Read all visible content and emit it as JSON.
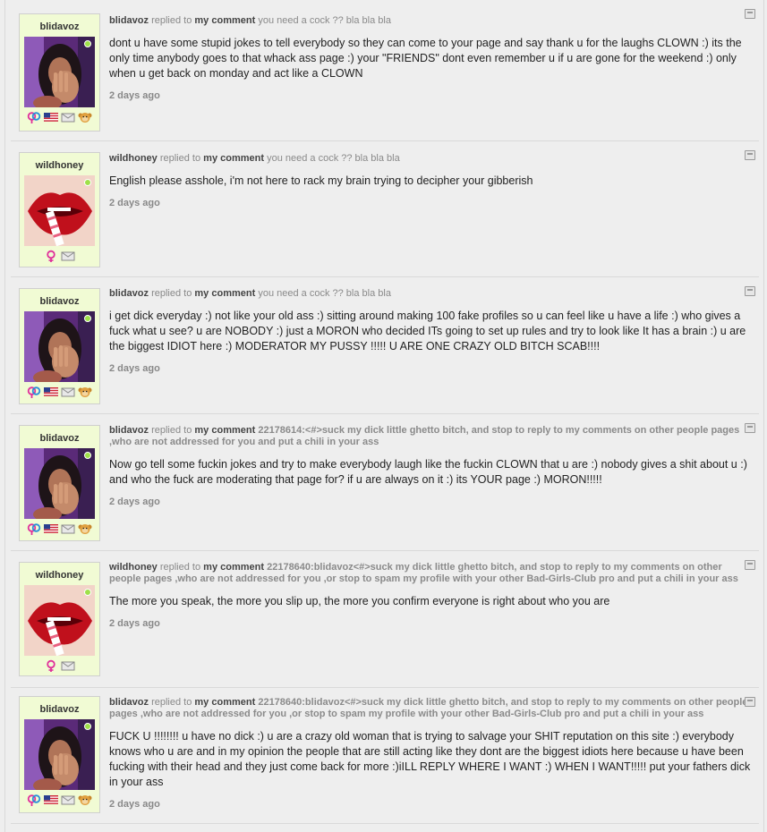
{
  "labels": {
    "replied_to": "replied to",
    "my_comment": "my comment"
  },
  "comments": [
    {
      "user": "blidavoz",
      "quote": "you need a cock ?? bla bla bla",
      "text": "dont u have some stupid jokes to tell everybody so they can come to your page and say thank u for the laughs CLOWN :) its the only time anybody goes to that whack ass page :) your \"FRIENDS\" dont even remember u if u are gone for the weekend :) only when u get back on monday and act like a CLOWN",
      "time": "2 days ago"
    },
    {
      "user": "wildhoney",
      "quote": "you need a cock ?? bla bla bla",
      "text": "English please asshole, i'm not here to rack my brain trying to decipher your gibberish",
      "time": "2 days ago"
    },
    {
      "user": "blidavoz",
      "quote": "you need a cock ?? bla bla bla",
      "text": "i get dick everyday :) not like your old ass :) sitting around making 100 fake profiles so u can feel like u have a life :) who gives a fuck what u see? u are NOBODY :) just a MORON who decided ITs going to set up rules and try to look like It has a brain :) u are the biggest IDIOT here :) MODERATOR MY PUSSY !!!!! U ARE ONE CRAZY OLD BITCH SCAB!!!!",
      "time": "2 days ago"
    },
    {
      "user": "blidavoz",
      "quote": "22178614:<#>suck my dick little ghetto bitch, and stop to reply to my comments on other people pages ,who are not addressed for you and put a chili in your ass",
      "text": "Now go tell some fuckin jokes and try to make everybody laugh like the fuckin CLOWN that u are :) nobody gives a shit about u :) and who the fuck are moderating that page for? if u are always on it :) its YOUR page :) MORON!!!!!",
      "time": "2 days ago"
    },
    {
      "user": "wildhoney",
      "quote": "22178640:blidavoz<#>suck my dick little ghetto bitch, and stop to reply to my comments on other people pages ,who are not addressed for you ,or stop to spam my profile with your other Bad-Girls-Club pro and put a chili in your ass",
      "text": "The more you speak, the more you slip up, the more you confirm everyone is right about who you are",
      "time": "2 days ago"
    },
    {
      "user": "blidavoz",
      "quote": "22178640:blidavoz<#>suck my dick little ghetto bitch, and stop to reply to my comments on other people pages ,who are not addressed for you ,or stop to spam my profile with your other Bad-Girls-Club pro and put a chili in your ass",
      "text": "FUCK U !!!!!!!! u have no dick :) u are a crazy old woman that is trying to salvage your SHIT reputation on this site :) everybody knows who u are and in my opinion the people that are still acting like they dont are the biggest idiots here because u have been fucking with their head and they just come back for more :)iILL REPLY WHERE I WANT :) WHEN I WANT!!!!! put your fathers dick in your ass",
      "time": "2 days ago"
    }
  ],
  "icons": {
    "gender_couple": "gender-couple-icon",
    "gender_female": "female-icon",
    "flag": "us-flag-icon",
    "mail": "mail-icon",
    "badge": "monkey-badge-icon",
    "report": "report-icon"
  },
  "colors": {
    "card_bg": "#f1fbd4",
    "page_bg": "#eeeeee",
    "female": "#e0309a",
    "male": "#2a8fd8",
    "online": "#9fe04a"
  }
}
